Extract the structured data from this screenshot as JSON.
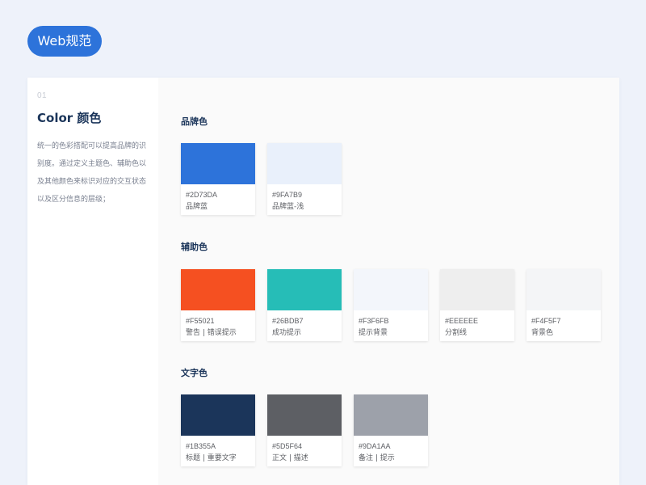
{
  "badge": {
    "label": "Web规范"
  },
  "section": {
    "number": "01",
    "title": "Color 颜色",
    "description_lines": [
      "统一的色彩搭配可以提高品牌的识",
      "别度。通过定义主题色、辅助色以",
      "及其他颜色来标识对应的交互状态",
      "以及区分信息的层级；"
    ]
  },
  "groups": [
    {
      "title": "品牌色",
      "swatches": [
        {
          "color": "#2D73DA",
          "hex": "#2D73DA",
          "name": "品牌蓝"
        },
        {
          "color": "#E9F0FB",
          "hex": "#9FA7B9",
          "name": "品牌蓝-浅"
        }
      ]
    },
    {
      "title": "辅助色",
      "swatches": [
        {
          "color": "#F55021",
          "hex": "#F55021",
          "name": "警告 | 错误提示"
        },
        {
          "color": "#26BDB7",
          "hex": "#26BDB7",
          "name": "成功提示"
        },
        {
          "color": "#F3F6FB",
          "hex": "#F3F6FB",
          "name": "提示背景"
        },
        {
          "color": "#EEEEEE",
          "hex": "#EEEEEE",
          "name": "分割线"
        },
        {
          "color": "#F4F5F7",
          "hex": "#F4F5F7",
          "name": "背景色"
        }
      ]
    },
    {
      "title": "文字色",
      "swatches": [
        {
          "color": "#1B355A",
          "hex": "#1B355A",
          "name": "标题 | 重要文字"
        },
        {
          "color": "#5D5F64",
          "hex": "#5D5F64",
          "name": "正文 | 描述"
        },
        {
          "color": "#9DA1AA",
          "hex": "#9DA1AA",
          "name": "备注 | 提示"
        }
      ]
    }
  ]
}
